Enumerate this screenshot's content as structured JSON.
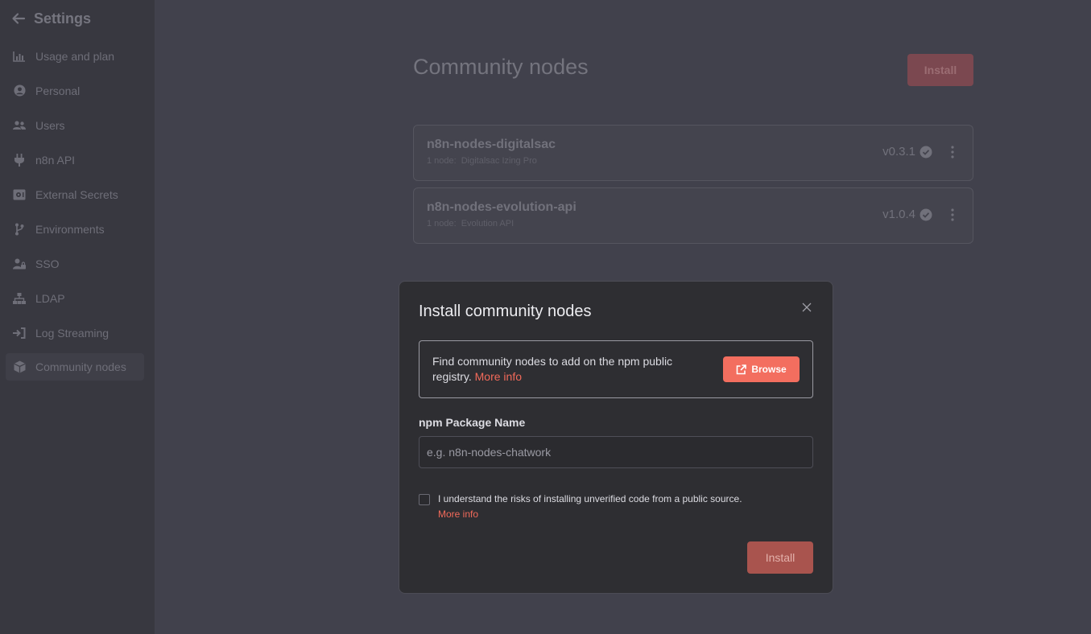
{
  "sidebar": {
    "title": "Settings",
    "items": [
      {
        "label": "Usage and plan",
        "icon": "chart-icon"
      },
      {
        "label": "Personal",
        "icon": "user-circle-icon"
      },
      {
        "label": "Users",
        "icon": "users-icon"
      },
      {
        "label": "n8n API",
        "icon": "plug-icon"
      },
      {
        "label": "External Secrets",
        "icon": "vault-icon"
      },
      {
        "label": "Environments",
        "icon": "branch-icon"
      },
      {
        "label": "SSO",
        "icon": "user-lock-icon"
      },
      {
        "label": "LDAP",
        "icon": "network-icon"
      },
      {
        "label": "Log Streaming",
        "icon": "sign-in-icon"
      },
      {
        "label": "Community nodes",
        "icon": "cube-icon",
        "active": true
      }
    ]
  },
  "main": {
    "title": "Community nodes",
    "install_label": "Install",
    "packages": [
      {
        "name": "n8n-nodes-digitalsac",
        "count": "1 node:",
        "nodes": "Digitalsac Izing Pro",
        "version": "v0.3.1"
      },
      {
        "name": "n8n-nodes-evolution-api",
        "count": "1 node:",
        "nodes": "Evolution API",
        "version": "v1.0.4"
      }
    ]
  },
  "modal": {
    "title": "Install community nodes",
    "info_text": "Find community nodes to add on the npm public registry.",
    "info_link": "More info",
    "browse_label": "Browse",
    "field_label": "npm Package Name",
    "input_placeholder": "e.g. n8n-nodes-chatwork",
    "input_value": "",
    "checkbox_label": "I understand the risks of installing unverified code from a public source.",
    "checkbox_link": "More info",
    "install_label": "Install"
  },
  "colors": {
    "accent": "#f36e5f",
    "background": "#41414c",
    "sidebar": "#383840",
    "modal": "#2e2e32"
  }
}
